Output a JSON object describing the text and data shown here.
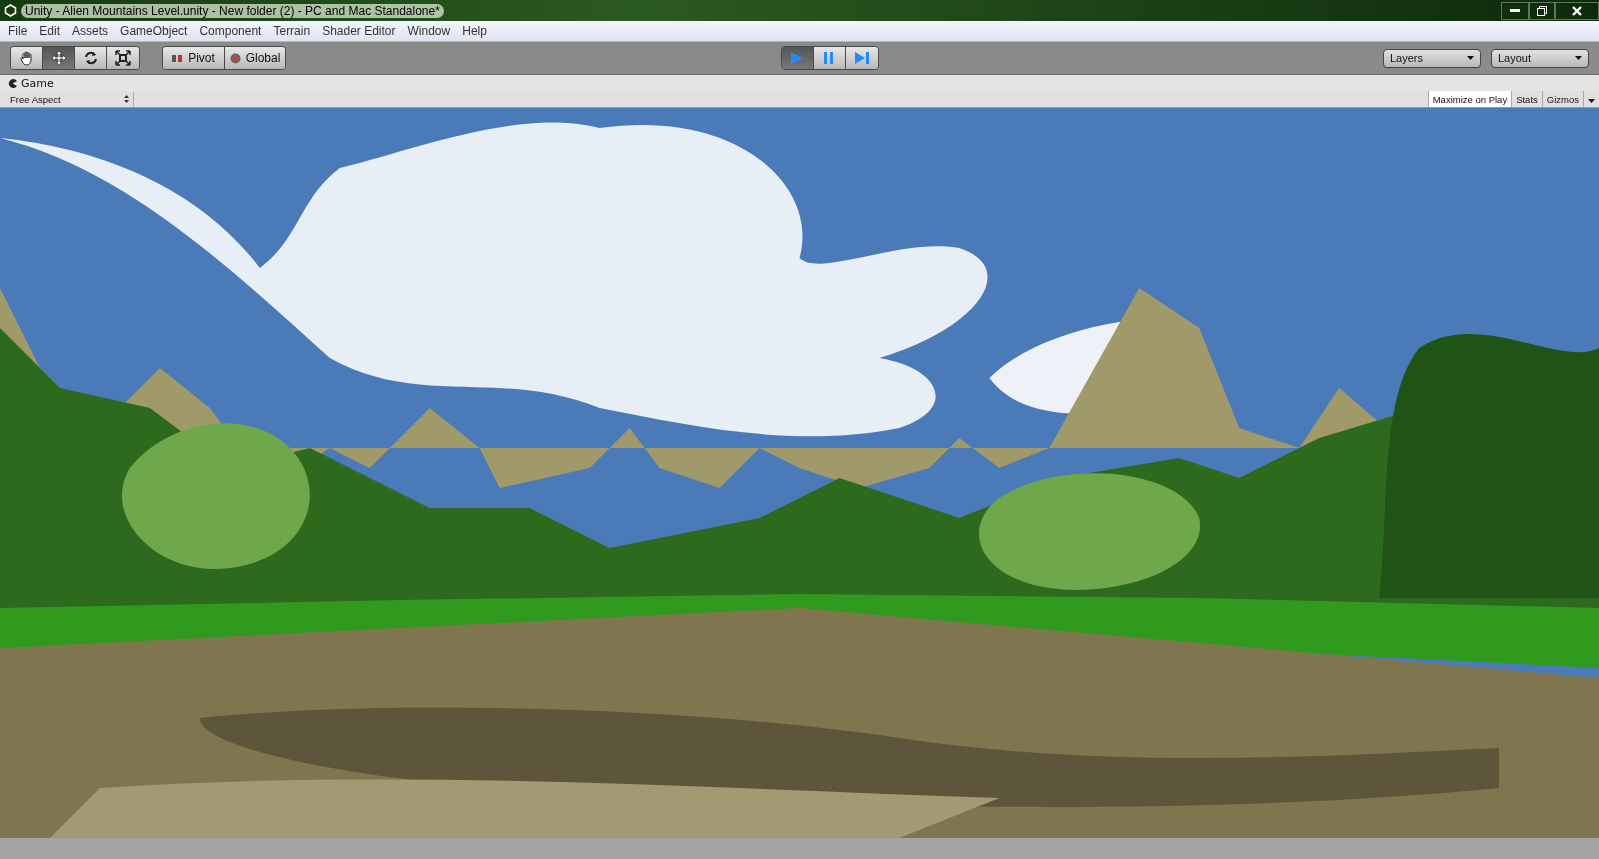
{
  "window": {
    "title": "Unity - Alien Mountains Level.unity - New folder (2) - PC and Mac Standalone*"
  },
  "menu": [
    "File",
    "Edit",
    "Assets",
    "GameObject",
    "Component",
    "Terrain",
    "Shader Editor",
    "Window",
    "Help"
  ],
  "tools": [
    {
      "kind": "hand",
      "selected": false
    },
    {
      "kind": "move",
      "selected": true
    },
    {
      "kind": "rotate",
      "selected": false
    },
    {
      "kind": "scale",
      "selected": false
    }
  ],
  "pivot_buttons": [
    {
      "kind": "pivot",
      "label": "Pivot"
    },
    {
      "kind": "global",
      "label": "Global"
    }
  ],
  "playback": [
    {
      "kind": "play",
      "selected": true
    },
    {
      "kind": "pause",
      "selected": false
    },
    {
      "kind": "step",
      "selected": false
    }
  ],
  "dropdowns": [
    "Layers",
    "Layout"
  ],
  "game_view": {
    "tab": "Game",
    "aspect": "Free Aspect",
    "options": [
      {
        "label": "Maximize on Play",
        "selected": true
      },
      {
        "label": "Stats",
        "selected": false
      },
      {
        "label": "Gizmos",
        "selected": false
      }
    ]
  }
}
